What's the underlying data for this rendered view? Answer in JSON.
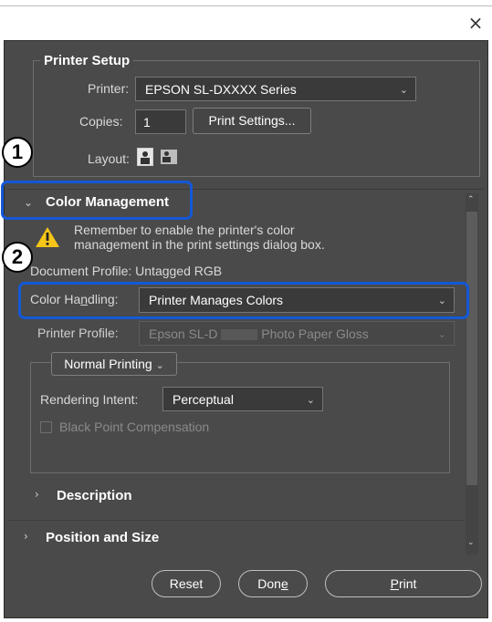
{
  "window": {
    "close_glyph": "×"
  },
  "printer_setup": {
    "title": "Printer Setup",
    "printer_label": "Printer:",
    "printer_value": "EPSON SL-DXXXX Series",
    "copies_label": "Copies:",
    "copies_value": "1",
    "print_settings_button": "Print Settings...",
    "layout_label": "Layout:"
  },
  "callouts": {
    "one": "1",
    "two": "2"
  },
  "color_management": {
    "title": "Color Management",
    "warning_line1": "Remember to enable the printer's color",
    "warning_line2": "management in the print settings dialog box.",
    "document_profile": "Document Profile: Untagged RGB",
    "color_handling_label_a": "Color Ha",
    "color_handling_label_u": "n",
    "color_handling_label_b": "dling:",
    "color_handling_value": "Printer Manages Colors",
    "printer_profile_label": "Printer Profile:",
    "printer_profile_value_a": "Epson SL-D",
    "printer_profile_value_b": "Photo Paper Gloss",
    "normal_printing": "Normal Printing",
    "rendering_intent_label": "Rendering Intent:",
    "rendering_intent_value": "Perceptual",
    "black_point": "Black Point Compensation"
  },
  "sections": {
    "description": "Description",
    "position_size": "Position and Size"
  },
  "footer": {
    "reset": "Reset",
    "done_a": "Don",
    "done_u": "e",
    "print_u": "P",
    "print_b": "rint"
  },
  "colors": {
    "callout": "#1458d6",
    "dialog_bg": "#4a4a4a",
    "warning": "#f5c518"
  }
}
